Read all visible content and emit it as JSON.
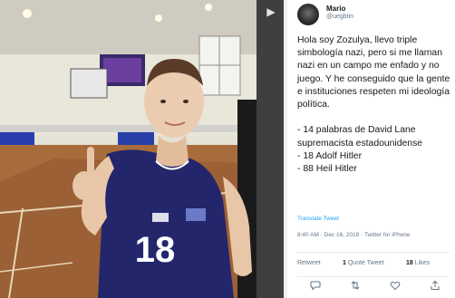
{
  "author": {
    "name": "Mario",
    "handle": "@uegbtin"
  },
  "tweet": {
    "text": "Hola soy Zozulya, llevo triple simbología nazi, pero si me llaman nazi en un campo me enfado y no juego. Y he conseguido que la gente e instituciones respeten mi ideología política.\n\n- 14 palabras de David Lane supremacista estadounidense\n- 18 Adolf Hitler\n- 88 Heil Hitler",
    "translate_label": "Translate Tweet",
    "meta": "8:40 AM · Dec 16, 2019 · Twitter for iPhone"
  },
  "stats": {
    "retweet_label": "Retweet",
    "quote_count": "1",
    "quote_label": "Quote Tweet",
    "like_count": "18",
    "like_label": "Likes"
  },
  "photo": {
    "jersey_number": "18"
  },
  "icons": {
    "next": "chevron-right-icon",
    "reply": "reply-icon",
    "retweet": "retweet-icon",
    "like": "heart-icon",
    "share": "share-icon"
  },
  "colors": {
    "jersey": "#23266b",
    "court": "#a86c3c",
    "link": "#1da1f2",
    "secondary_text": "#657786"
  }
}
